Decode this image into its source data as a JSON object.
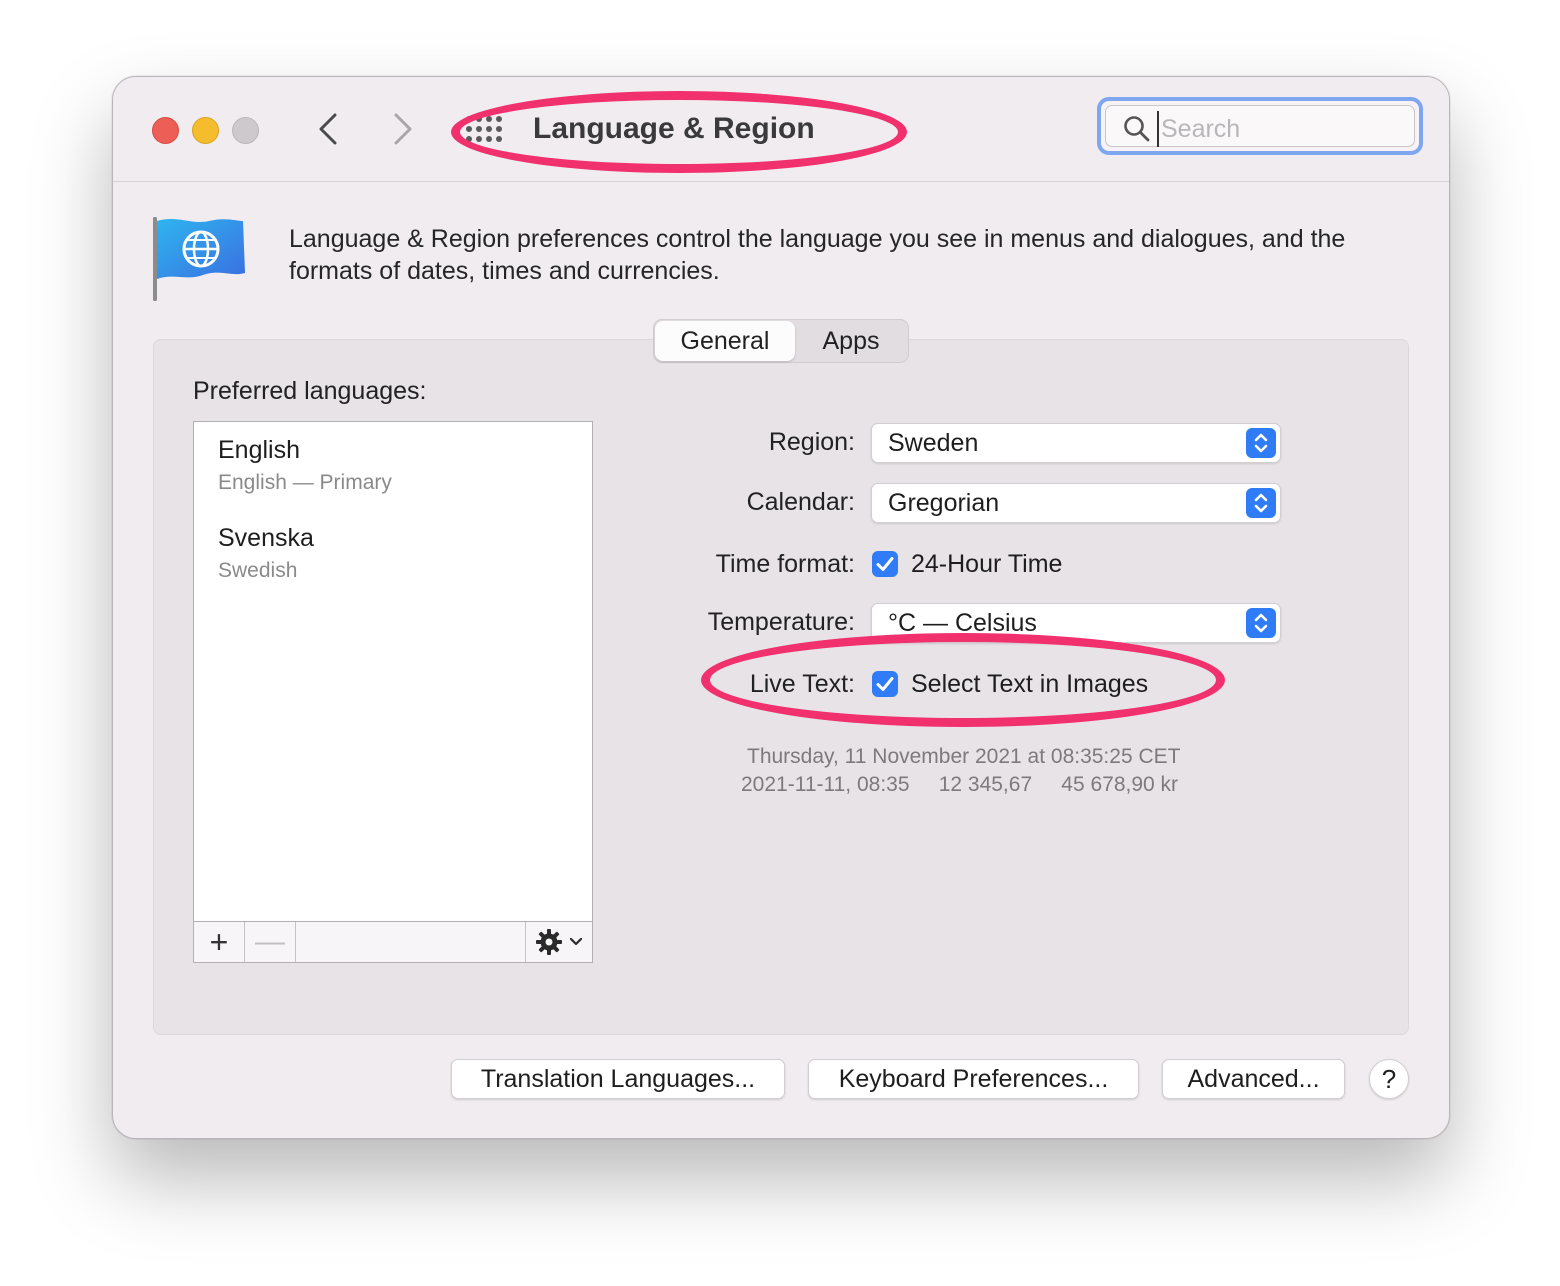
{
  "window": {
    "title": "Language & Region",
    "search_placeholder": "Search"
  },
  "description": "Language & Region preferences control the language you see in menus and dialogues, and the formats of dates, times and currencies.",
  "tabs": [
    {
      "label": "General",
      "selected": true
    },
    {
      "label": "Apps",
      "selected": false
    }
  ],
  "preferred_languages": {
    "label": "Preferred languages:",
    "items": [
      {
        "name": "English",
        "detail": "English — Primary"
      },
      {
        "name": "Svenska",
        "detail": "Swedish"
      }
    ],
    "toolbar": {
      "add": "+",
      "remove": "—"
    }
  },
  "settings": {
    "region": {
      "label": "Region:",
      "value": "Sweden"
    },
    "calendar": {
      "label": "Calendar:",
      "value": "Gregorian"
    },
    "time_format": {
      "label": "Time format:",
      "checkbox_label": "24-Hour Time",
      "checked": true
    },
    "temperature": {
      "label": "Temperature:",
      "value": "°C — Celsius"
    },
    "live_text": {
      "label": "Live Text:",
      "checkbox_label": "Select Text in Images",
      "checked": true
    }
  },
  "sample": {
    "line1": "Thursday, 11 November 2021 at 08:35:25 CET",
    "line2": "2021-11-11, 08:35     12 345,67     45 678,90 kr"
  },
  "buttons": {
    "translation": "Translation Languages...",
    "keyboard": "Keyboard Preferences...",
    "advanced": "Advanced...",
    "help": "?"
  },
  "colors": {
    "accent": "#2f7cf6",
    "annotation": "#f1306e",
    "window_bg": "#f1ecf0"
  },
  "icons": [
    "back-chevron-icon",
    "forward-chevron-icon",
    "grid-icon",
    "search-icon",
    "globe-flag-icon",
    "gear-icon",
    "chevron-down-icon",
    "checkmark-icon",
    "updown-arrows-icon"
  ]
}
